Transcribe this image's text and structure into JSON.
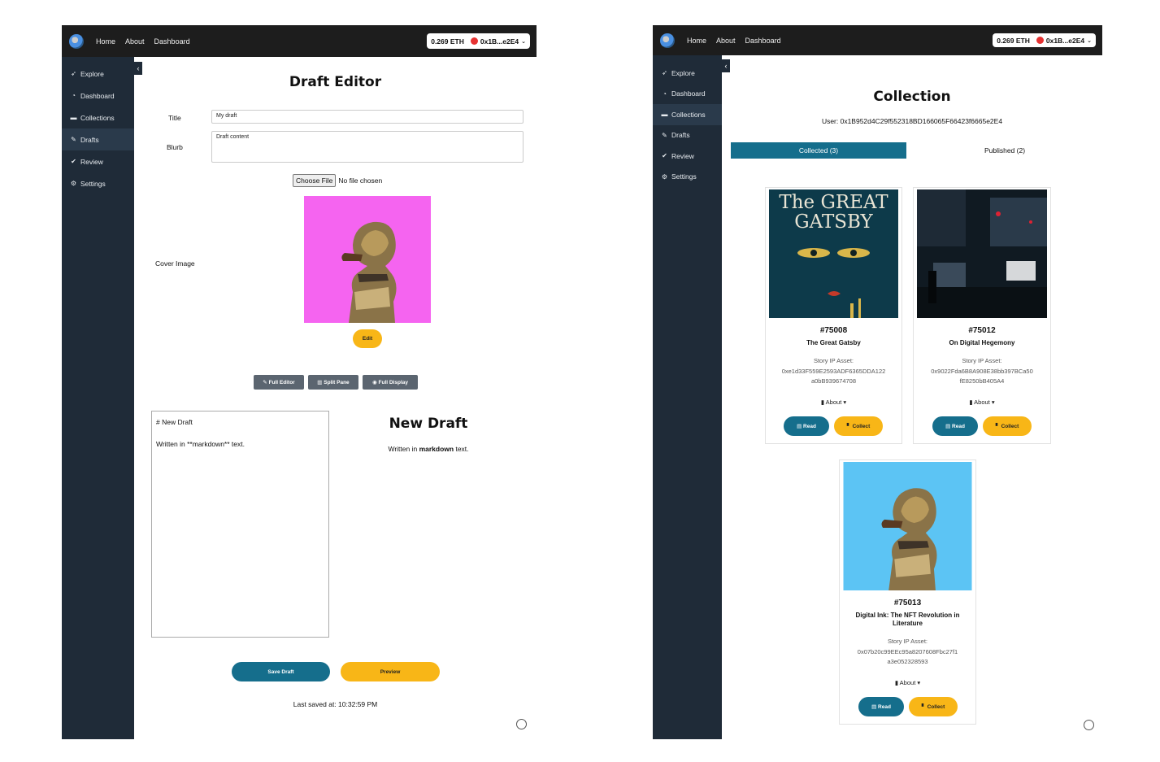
{
  "left": {
    "topbar": {
      "nav": [
        "Home",
        "About",
        "Dashboard"
      ],
      "balance": "0.269 ETH",
      "account": "0x1B...e2E4"
    },
    "sidebar": [
      {
        "label": "Explore",
        "icon": "rocket-icon"
      },
      {
        "label": "Dashboard",
        "icon": "gauge-icon"
      },
      {
        "label": "Collections",
        "icon": "folder-icon"
      },
      {
        "label": "Drafts",
        "icon": "drafts-icon"
      },
      {
        "label": "Review",
        "icon": "check-icon"
      },
      {
        "label": "Settings",
        "icon": "gear-icon"
      }
    ],
    "title": "Draft Editor",
    "form": {
      "title_label": "Title",
      "title_value": "My draft",
      "blurb_label": "Blurb",
      "blurb_value": "Draft content",
      "file_button": "Choose File",
      "file_status": "No file chosen",
      "cover_label": "Cover Image",
      "edit_label": "Edit"
    },
    "modes": {
      "full_editor": "Full Editor",
      "split_pane": "Split Pane",
      "full_display": "Full Display"
    },
    "editor": {
      "line1": "# New Draft",
      "line2": "Written in **markdown** text."
    },
    "preview": {
      "heading": "New Draft",
      "before": "Written in ",
      "bold": "markdown",
      "after": " text."
    },
    "save_label": "Save Draft",
    "preview_label": "Preview",
    "last_saved": "Last saved at: 10:32:59 PM",
    "colors": {
      "teal": "#156e8c",
      "gold": "#f8b617",
      "sidebar": "#1f2b38",
      "cover_bg": "#f564f0"
    }
  },
  "right": {
    "topbar": {
      "nav": [
        "Home",
        "About",
        "Dashboard"
      ],
      "balance": "0.269 ETH",
      "account": "0x1B...e2E4"
    },
    "sidebar": [
      {
        "label": "Explore",
        "icon": "rocket-icon"
      },
      {
        "label": "Dashboard",
        "icon": "gauge-icon"
      },
      {
        "label": "Collections",
        "icon": "folder-icon"
      },
      {
        "label": "Drafts",
        "icon": "drafts-icon"
      },
      {
        "label": "Review",
        "icon": "check-icon"
      },
      {
        "label": "Settings",
        "icon": "gear-icon"
      }
    ],
    "title": "Collection",
    "user": "User: 0x1B952d4C29f552318BD166065F66423f6665e2E4",
    "tabs": {
      "collected": "Collected (3)",
      "published": "Published (2)"
    },
    "cards": [
      {
        "id": "#75008",
        "title": "The Great Gatsby",
        "asset_label": "Story IP Asset:",
        "asset_1": "0xe1d33F559E2593ADF6365DDA122",
        "asset_2": "a0bB939674708",
        "about": "About",
        "read": "Read",
        "collect": "Collect",
        "cover_title_1": "The GREAT",
        "cover_title_2": "GATSBY"
      },
      {
        "id": "#75012",
        "title": "On Digital Hegemony",
        "asset_label": "Story IP Asset:",
        "asset_1": "0x9022Fda6B8A908E38bb397BCa50",
        "asset_2": "fE8250bB405A4",
        "about": "About",
        "read": "Read",
        "collect": "Collect"
      },
      {
        "id": "#75013",
        "title": "Digital Ink: The NFT Revolution in Literature",
        "asset_label": "Story IP Asset:",
        "asset_1": "0x07b20c99EEc95a8207608Fbc27f1",
        "asset_2": "a3e052328593",
        "about": "About",
        "read": "Read",
        "collect": "Collect"
      }
    ]
  }
}
